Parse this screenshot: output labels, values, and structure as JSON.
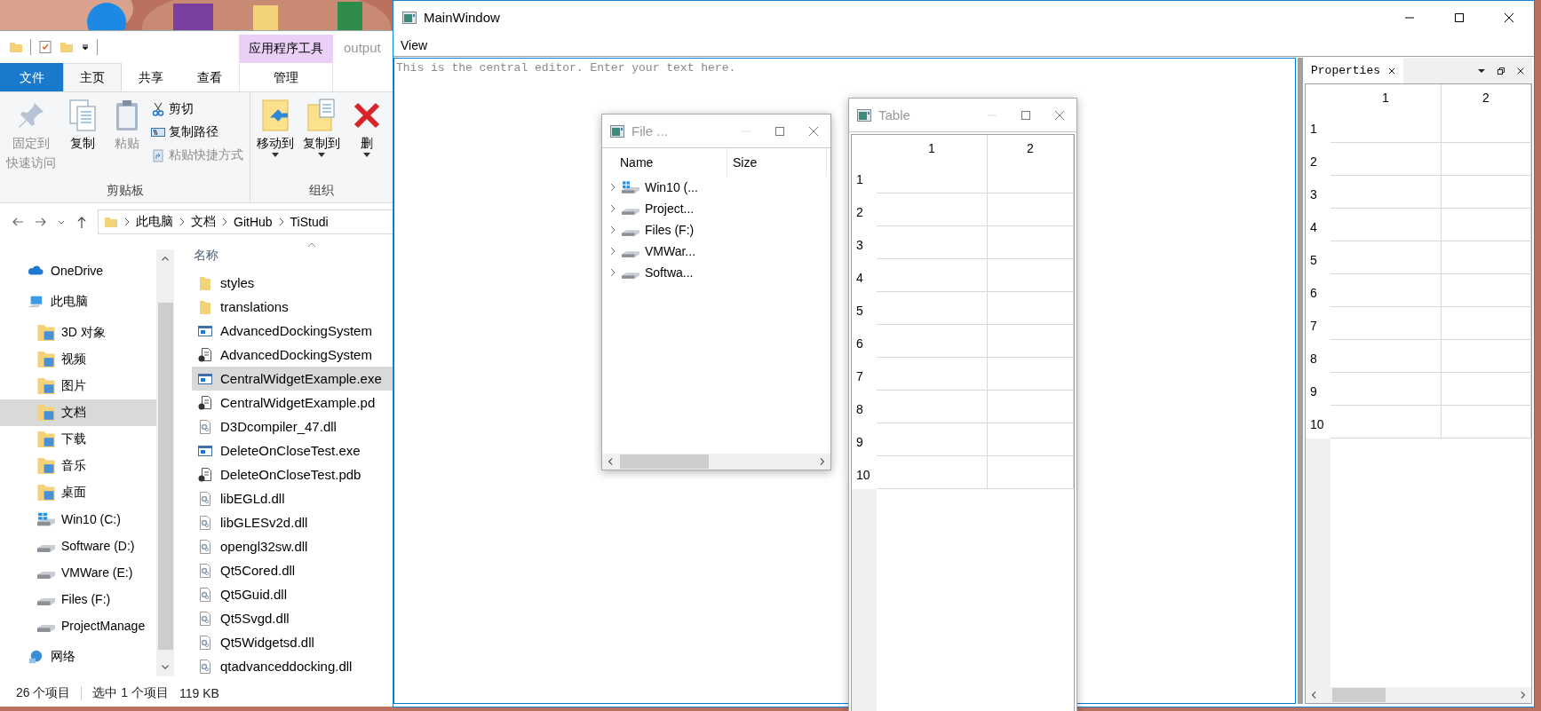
{
  "explorer": {
    "title": "output",
    "context_tab_group": "应用程序工具",
    "ribbon_tabs": [
      {
        "label": "文件",
        "kind": "file",
        "selected": false
      },
      {
        "label": "主页",
        "kind": "tab",
        "selected": true
      },
      {
        "label": "共享",
        "kind": "tab",
        "selected": false
      },
      {
        "label": "查看",
        "kind": "tab",
        "selected": false
      },
      {
        "label": "管理",
        "kind": "context",
        "selected": false
      }
    ],
    "ribbon_groups": [
      {
        "label": "剪贴板",
        "commands": [
          {
            "label": "固定到",
            "label_2": "快速访问",
            "kind": "large",
            "disabled": true,
            "menu": false
          },
          {
            "label": "复制",
            "kind": "large",
            "disabled": false,
            "menu": false
          },
          {
            "label": "粘贴",
            "kind": "large",
            "disabled": true,
            "menu": false
          },
          {
            "label": "剪切",
            "kind": "small",
            "disabled": false,
            "menu": false
          },
          {
            "label": "复制路径",
            "kind": "small",
            "disabled": false,
            "menu": false
          },
          {
            "label": "粘贴快捷方式",
            "kind": "small",
            "disabled": true,
            "menu": false
          }
        ]
      },
      {
        "label": "组织",
        "commands": [
          {
            "label": "移动到",
            "kind": "large",
            "disabled": false,
            "menu": true
          },
          {
            "label": "复制到",
            "kind": "large",
            "disabled": false,
            "menu": true
          },
          {
            "label": "删",
            "kind": "large",
            "disabled": false,
            "menu": true
          }
        ]
      }
    ],
    "address": [
      "此电脑",
      "文档",
      "GitHub",
      "TiStudi"
    ],
    "nav": [
      {
        "label": "OneDrive",
        "kind": "cloud",
        "selected": false
      },
      {
        "label": "此电脑",
        "kind": "computer",
        "selected": false,
        "children": [
          {
            "label": "3D 对象",
            "kind": "folder",
            "selected": false
          },
          {
            "label": "视频",
            "kind": "folder",
            "selected": false
          },
          {
            "label": "图片",
            "kind": "folder",
            "selected": false
          },
          {
            "label": "文档",
            "kind": "folder",
            "selected": true
          },
          {
            "label": "下载",
            "kind": "folder",
            "selected": false
          },
          {
            "label": "音乐",
            "kind": "folder",
            "selected": false
          },
          {
            "label": "桌面",
            "kind": "folder",
            "selected": false
          },
          {
            "label": "Win10 (C:)",
            "kind": "system-drive",
            "selected": false
          },
          {
            "label": "Software (D:)",
            "kind": "drive",
            "selected": false
          },
          {
            "label": "VMWare (E:)",
            "kind": "drive",
            "selected": false
          },
          {
            "label": "Files (F:)",
            "kind": "drive",
            "selected": false
          },
          {
            "label": "ProjectManage",
            "kind": "drive",
            "selected": false
          }
        ]
      },
      {
        "label": "网络",
        "kind": "network",
        "selected": false
      }
    ],
    "column_header": "名称",
    "files": [
      {
        "name": "styles",
        "kind": "folder",
        "selected": false
      },
      {
        "name": "translations",
        "kind": "folder",
        "selected": false
      },
      {
        "name": "AdvancedDockingSystem",
        "kind": "exe",
        "selected": false
      },
      {
        "name": "AdvancedDockingSystem",
        "kind": "pdb",
        "selected": false
      },
      {
        "name": "CentralWidgetExample.exe",
        "kind": "exe",
        "selected": true
      },
      {
        "name": "CentralWidgetExample.pd",
        "kind": "pdb",
        "selected": false
      },
      {
        "name": "D3Dcompiler_47.dll",
        "kind": "dll",
        "selected": false
      },
      {
        "name": "DeleteOnCloseTest.exe",
        "kind": "exe",
        "selected": false
      },
      {
        "name": "DeleteOnCloseTest.pdb",
        "kind": "pdb",
        "selected": false
      },
      {
        "name": "libEGLd.dll",
        "kind": "dll",
        "selected": false
      },
      {
        "name": "libGLESv2d.dll",
        "kind": "dll",
        "selected": false
      },
      {
        "name": "opengl32sw.dll",
        "kind": "dll",
        "selected": false
      },
      {
        "name": "Qt5Cored.dll",
        "kind": "dll",
        "selected": false
      },
      {
        "name": "Qt5Guid.dll",
        "kind": "dll",
        "selected": false
      },
      {
        "name": "Qt5Svgd.dll",
        "kind": "dll",
        "selected": false
      },
      {
        "name": "Qt5Widgetsd.dll",
        "kind": "dll",
        "selected": false
      },
      {
        "name": "qtadvanceddocking.dll",
        "kind": "dll",
        "selected": false
      }
    ],
    "status": {
      "count": "26 个项目",
      "selection": "选中 1 个项目",
      "size": "119 KB"
    }
  },
  "main_window": {
    "title": "MainWindow",
    "menu": [
      "View"
    ],
    "editor": {
      "placeholder": "This is the central editor. Enter your text here."
    },
    "dock": {
      "tab": "Properties",
      "table": {
        "columns": [
          "1",
          "2"
        ],
        "rows": [
          "1",
          "2",
          "3",
          "4",
          "5",
          "6",
          "7",
          "8",
          "9",
          "10"
        ]
      }
    }
  },
  "file_window": {
    "title": "File ...",
    "columns": [
      "Name",
      "Size"
    ],
    "items": [
      {
        "label": "Win10 (...",
        "kind": "system-drive",
        "expanded": false
      },
      {
        "label": "Project...",
        "kind": "drive",
        "expanded": false
      },
      {
        "label": "Files (F:)",
        "kind": "drive",
        "expanded": false
      },
      {
        "label": "VMWar...",
        "kind": "drive",
        "expanded": false
      },
      {
        "label": "Softwa...",
        "kind": "drive",
        "expanded": false
      }
    ]
  },
  "table_window": {
    "title": "Table",
    "table": {
      "columns": [
        "1",
        "2"
      ],
      "rows": [
        "1",
        "2",
        "3",
        "4",
        "5",
        "6",
        "7",
        "8",
        "9",
        "10"
      ]
    }
  }
}
